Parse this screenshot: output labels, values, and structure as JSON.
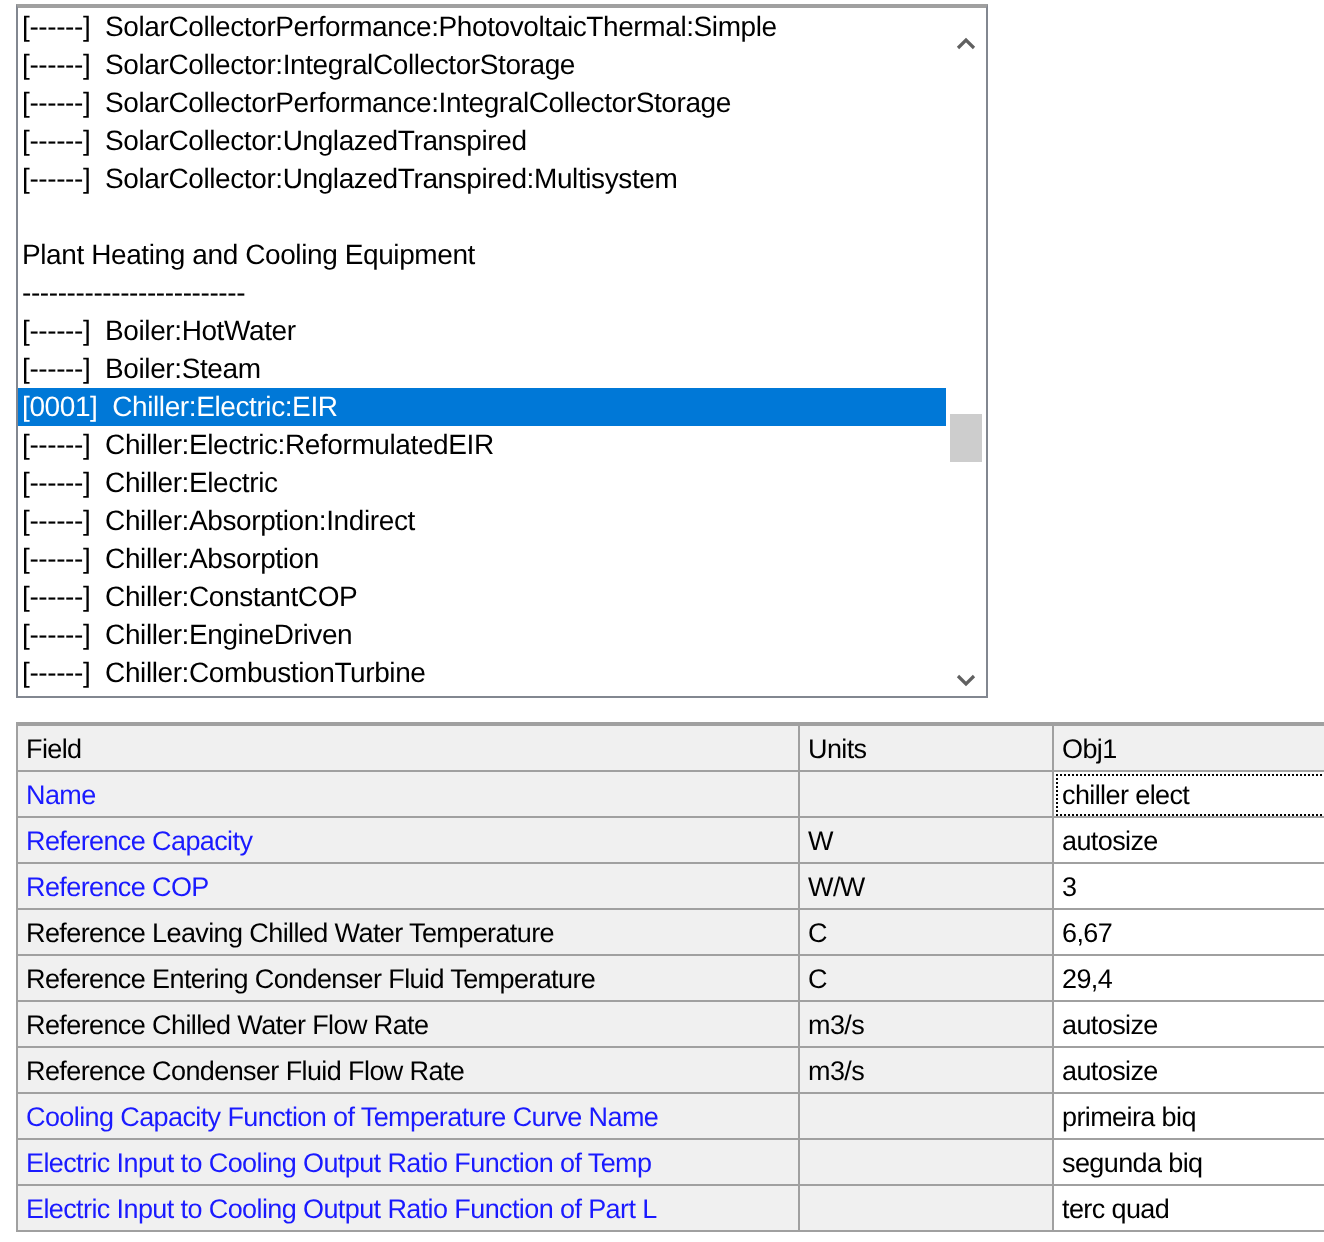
{
  "object_list": {
    "items": [
      {
        "kind": "object",
        "count": "[------]",
        "name": "SolarCollectorPerformance:PhotovoltaicThermal:Simple",
        "selected": false
      },
      {
        "kind": "object",
        "count": "[------]",
        "name": "SolarCollector:IntegralCollectorStorage",
        "selected": false
      },
      {
        "kind": "object",
        "count": "[------]",
        "name": "SolarCollectorPerformance:IntegralCollectorStorage",
        "selected": false
      },
      {
        "kind": "object",
        "count": "[------]",
        "name": "SolarCollector:UnglazedTranspired",
        "selected": false
      },
      {
        "kind": "object",
        "count": "[------]",
        "name": "SolarCollector:UnglazedTranspired:Multisystem",
        "selected": false
      },
      {
        "kind": "blank"
      },
      {
        "kind": "heading",
        "text": "Plant Heating and Cooling Equipment"
      },
      {
        "kind": "heading",
        "text": "-------------------------"
      },
      {
        "kind": "object",
        "count": "[------]",
        "name": "Boiler:HotWater",
        "selected": false
      },
      {
        "kind": "object",
        "count": "[------]",
        "name": "Boiler:Steam",
        "selected": false
      },
      {
        "kind": "object",
        "count": "[0001]",
        "name": "Chiller:Electric:EIR",
        "selected": true
      },
      {
        "kind": "object",
        "count": "[------]",
        "name": "Chiller:Electric:ReformulatedEIR",
        "selected": false
      },
      {
        "kind": "object",
        "count": "[------]",
        "name": "Chiller:Electric",
        "selected": false
      },
      {
        "kind": "object",
        "count": "[------]",
        "name": "Chiller:Absorption:Indirect",
        "selected": false
      },
      {
        "kind": "object",
        "count": "[------]",
        "name": "Chiller:Absorption",
        "selected": false
      },
      {
        "kind": "object",
        "count": "[------]",
        "name": "Chiller:ConstantCOP",
        "selected": false
      },
      {
        "kind": "object",
        "count": "[------]",
        "name": "Chiller:EngineDriven",
        "selected": false
      },
      {
        "kind": "object",
        "count": "[------]",
        "name": "Chiller:CombustionTurbine",
        "selected": false
      }
    ]
  },
  "table": {
    "columns": [
      "Field",
      "Units",
      "Obj1"
    ],
    "rows": [
      {
        "field": "Name",
        "units": "",
        "value": "chiller elect",
        "required": true,
        "focused": true
      },
      {
        "field": "Reference Capacity",
        "units": "W",
        "value": "autosize",
        "required": true,
        "focused": false
      },
      {
        "field": "Reference COP",
        "units": "W/W",
        "value": "3",
        "required": true,
        "focused": false
      },
      {
        "field": "Reference Leaving Chilled Water Temperature",
        "units": "C",
        "value": "6,67",
        "required": false,
        "focused": false
      },
      {
        "field": "Reference Entering Condenser Fluid Temperature",
        "units": "C",
        "value": "29,4",
        "required": false,
        "focused": false
      },
      {
        "field": "Reference Chilled Water Flow Rate",
        "units": "m3/s",
        "value": "autosize",
        "required": false,
        "focused": false
      },
      {
        "field": "Reference Condenser Fluid Flow Rate",
        "units": "m3/s",
        "value": "autosize",
        "required": false,
        "focused": false
      },
      {
        "field": "Cooling Capacity Function of Temperature Curve Name",
        "units": "",
        "value": "primeira biq",
        "required": true,
        "focused": false
      },
      {
        "field": "Electric Input to Cooling Output Ratio Function of Temp",
        "units": "",
        "value": "segunda biq",
        "required": true,
        "focused": false
      },
      {
        "field": "Electric Input to Cooling Output Ratio Function of Part L",
        "units": "",
        "value": "terc quad",
        "required": true,
        "focused": false
      }
    ]
  }
}
